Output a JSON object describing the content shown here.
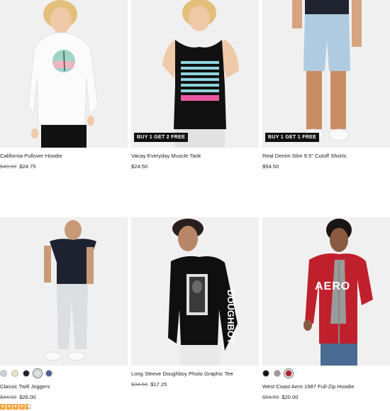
{
  "products": [
    {
      "name": "California Pullover Hoodie",
      "old_price": "$49.50",
      "price": "$24.75",
      "badge": ""
    },
    {
      "name": "Vacay Everyday Muscle Tank",
      "old_price": "",
      "price": "$24.50",
      "badge": "BUY 1 GET 2 FREE"
    },
    {
      "name": "Real Denim Slim 9.5\" Cutoff Shorts",
      "old_price": "",
      "price": "$54.50",
      "badge": "BUY 1 GET 1 FREE"
    },
    {
      "name": "Classic Twill Joggers",
      "old_price": "$44.50",
      "price": "$26.00",
      "badge": "",
      "swatches": [
        "#c9d2d6",
        "#e9e0c8",
        "#1d1f2b",
        "#dfe6e2",
        "#4b5f8e"
      ],
      "selected_swatch": 3,
      "rating": 4.5
    },
    {
      "name": "Long Sleeve Doughboy Photo Graphic Tee",
      "old_price": "$34.50",
      "price": "$17.25",
      "badge": ""
    },
    {
      "name": "West Coast Aero 1987 Full-Zip Hoodie",
      "old_price": "$54.50",
      "price": "$20.00",
      "badge": "",
      "swatches": [
        "#151515",
        "#9a9a9a",
        "#b51e2e"
      ],
      "selected_swatch": 2
    }
  ],
  "graphics": {
    "tee_sleeve_text": "DOUGHBOY",
    "hoodie_chest_text": "AERO"
  }
}
